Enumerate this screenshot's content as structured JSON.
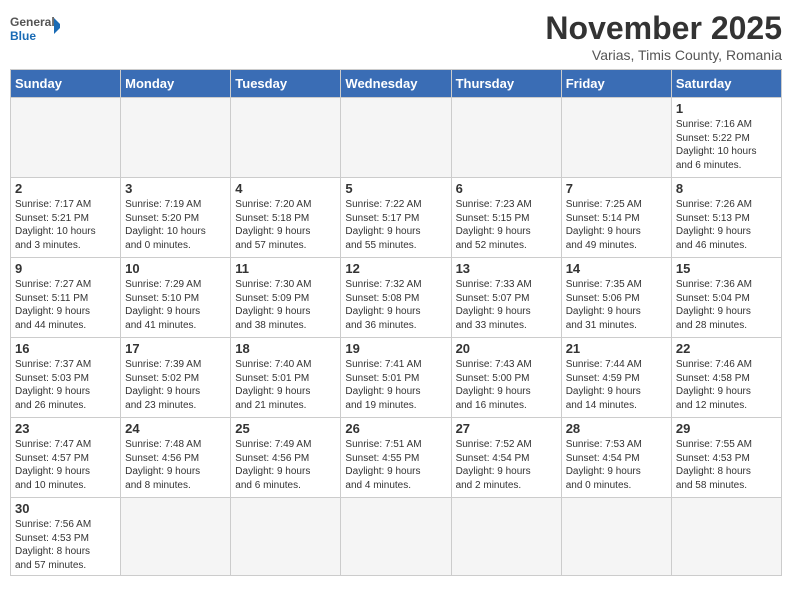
{
  "header": {
    "logo_general": "General",
    "logo_blue": "Blue",
    "month_title": "November 2025",
    "subtitle": "Varias, Timis County, Romania"
  },
  "weekdays": [
    "Sunday",
    "Monday",
    "Tuesday",
    "Wednesday",
    "Thursday",
    "Friday",
    "Saturday"
  ],
  "weeks": [
    [
      {
        "day": "",
        "info": ""
      },
      {
        "day": "",
        "info": ""
      },
      {
        "day": "",
        "info": ""
      },
      {
        "day": "",
        "info": ""
      },
      {
        "day": "",
        "info": ""
      },
      {
        "day": "",
        "info": ""
      },
      {
        "day": "1",
        "info": "Sunrise: 7:16 AM\nSunset: 5:22 PM\nDaylight: 10 hours\nand 6 minutes."
      }
    ],
    [
      {
        "day": "2",
        "info": "Sunrise: 7:17 AM\nSunset: 5:21 PM\nDaylight: 10 hours\nand 3 minutes."
      },
      {
        "day": "3",
        "info": "Sunrise: 7:19 AM\nSunset: 5:20 PM\nDaylight: 10 hours\nand 0 minutes."
      },
      {
        "day": "4",
        "info": "Sunrise: 7:20 AM\nSunset: 5:18 PM\nDaylight: 9 hours\nand 57 minutes."
      },
      {
        "day": "5",
        "info": "Sunrise: 7:22 AM\nSunset: 5:17 PM\nDaylight: 9 hours\nand 55 minutes."
      },
      {
        "day": "6",
        "info": "Sunrise: 7:23 AM\nSunset: 5:15 PM\nDaylight: 9 hours\nand 52 minutes."
      },
      {
        "day": "7",
        "info": "Sunrise: 7:25 AM\nSunset: 5:14 PM\nDaylight: 9 hours\nand 49 minutes."
      },
      {
        "day": "8",
        "info": "Sunrise: 7:26 AM\nSunset: 5:13 PM\nDaylight: 9 hours\nand 46 minutes."
      }
    ],
    [
      {
        "day": "9",
        "info": "Sunrise: 7:27 AM\nSunset: 5:11 PM\nDaylight: 9 hours\nand 44 minutes."
      },
      {
        "day": "10",
        "info": "Sunrise: 7:29 AM\nSunset: 5:10 PM\nDaylight: 9 hours\nand 41 minutes."
      },
      {
        "day": "11",
        "info": "Sunrise: 7:30 AM\nSunset: 5:09 PM\nDaylight: 9 hours\nand 38 minutes."
      },
      {
        "day": "12",
        "info": "Sunrise: 7:32 AM\nSunset: 5:08 PM\nDaylight: 9 hours\nand 36 minutes."
      },
      {
        "day": "13",
        "info": "Sunrise: 7:33 AM\nSunset: 5:07 PM\nDaylight: 9 hours\nand 33 minutes."
      },
      {
        "day": "14",
        "info": "Sunrise: 7:35 AM\nSunset: 5:06 PM\nDaylight: 9 hours\nand 31 minutes."
      },
      {
        "day": "15",
        "info": "Sunrise: 7:36 AM\nSunset: 5:04 PM\nDaylight: 9 hours\nand 28 minutes."
      }
    ],
    [
      {
        "day": "16",
        "info": "Sunrise: 7:37 AM\nSunset: 5:03 PM\nDaylight: 9 hours\nand 26 minutes."
      },
      {
        "day": "17",
        "info": "Sunrise: 7:39 AM\nSunset: 5:02 PM\nDaylight: 9 hours\nand 23 minutes."
      },
      {
        "day": "18",
        "info": "Sunrise: 7:40 AM\nSunset: 5:01 PM\nDaylight: 9 hours\nand 21 minutes."
      },
      {
        "day": "19",
        "info": "Sunrise: 7:41 AM\nSunset: 5:01 PM\nDaylight: 9 hours\nand 19 minutes."
      },
      {
        "day": "20",
        "info": "Sunrise: 7:43 AM\nSunset: 5:00 PM\nDaylight: 9 hours\nand 16 minutes."
      },
      {
        "day": "21",
        "info": "Sunrise: 7:44 AM\nSunset: 4:59 PM\nDaylight: 9 hours\nand 14 minutes."
      },
      {
        "day": "22",
        "info": "Sunrise: 7:46 AM\nSunset: 4:58 PM\nDaylight: 9 hours\nand 12 minutes."
      }
    ],
    [
      {
        "day": "23",
        "info": "Sunrise: 7:47 AM\nSunset: 4:57 PM\nDaylight: 9 hours\nand 10 minutes."
      },
      {
        "day": "24",
        "info": "Sunrise: 7:48 AM\nSunset: 4:56 PM\nDaylight: 9 hours\nand 8 minutes."
      },
      {
        "day": "25",
        "info": "Sunrise: 7:49 AM\nSunset: 4:56 PM\nDaylight: 9 hours\nand 6 minutes."
      },
      {
        "day": "26",
        "info": "Sunrise: 7:51 AM\nSunset: 4:55 PM\nDaylight: 9 hours\nand 4 minutes."
      },
      {
        "day": "27",
        "info": "Sunrise: 7:52 AM\nSunset: 4:54 PM\nDaylight: 9 hours\nand 2 minutes."
      },
      {
        "day": "28",
        "info": "Sunrise: 7:53 AM\nSunset: 4:54 PM\nDaylight: 9 hours\nand 0 minutes."
      },
      {
        "day": "29",
        "info": "Sunrise: 7:55 AM\nSunset: 4:53 PM\nDaylight: 8 hours\nand 58 minutes."
      }
    ],
    [
      {
        "day": "30",
        "info": "Sunrise: 7:56 AM\nSunset: 4:53 PM\nDaylight: 8 hours\nand 57 minutes."
      },
      {
        "day": "",
        "info": ""
      },
      {
        "day": "",
        "info": ""
      },
      {
        "day": "",
        "info": ""
      },
      {
        "day": "",
        "info": ""
      },
      {
        "day": "",
        "info": ""
      },
      {
        "day": "",
        "info": ""
      }
    ]
  ]
}
